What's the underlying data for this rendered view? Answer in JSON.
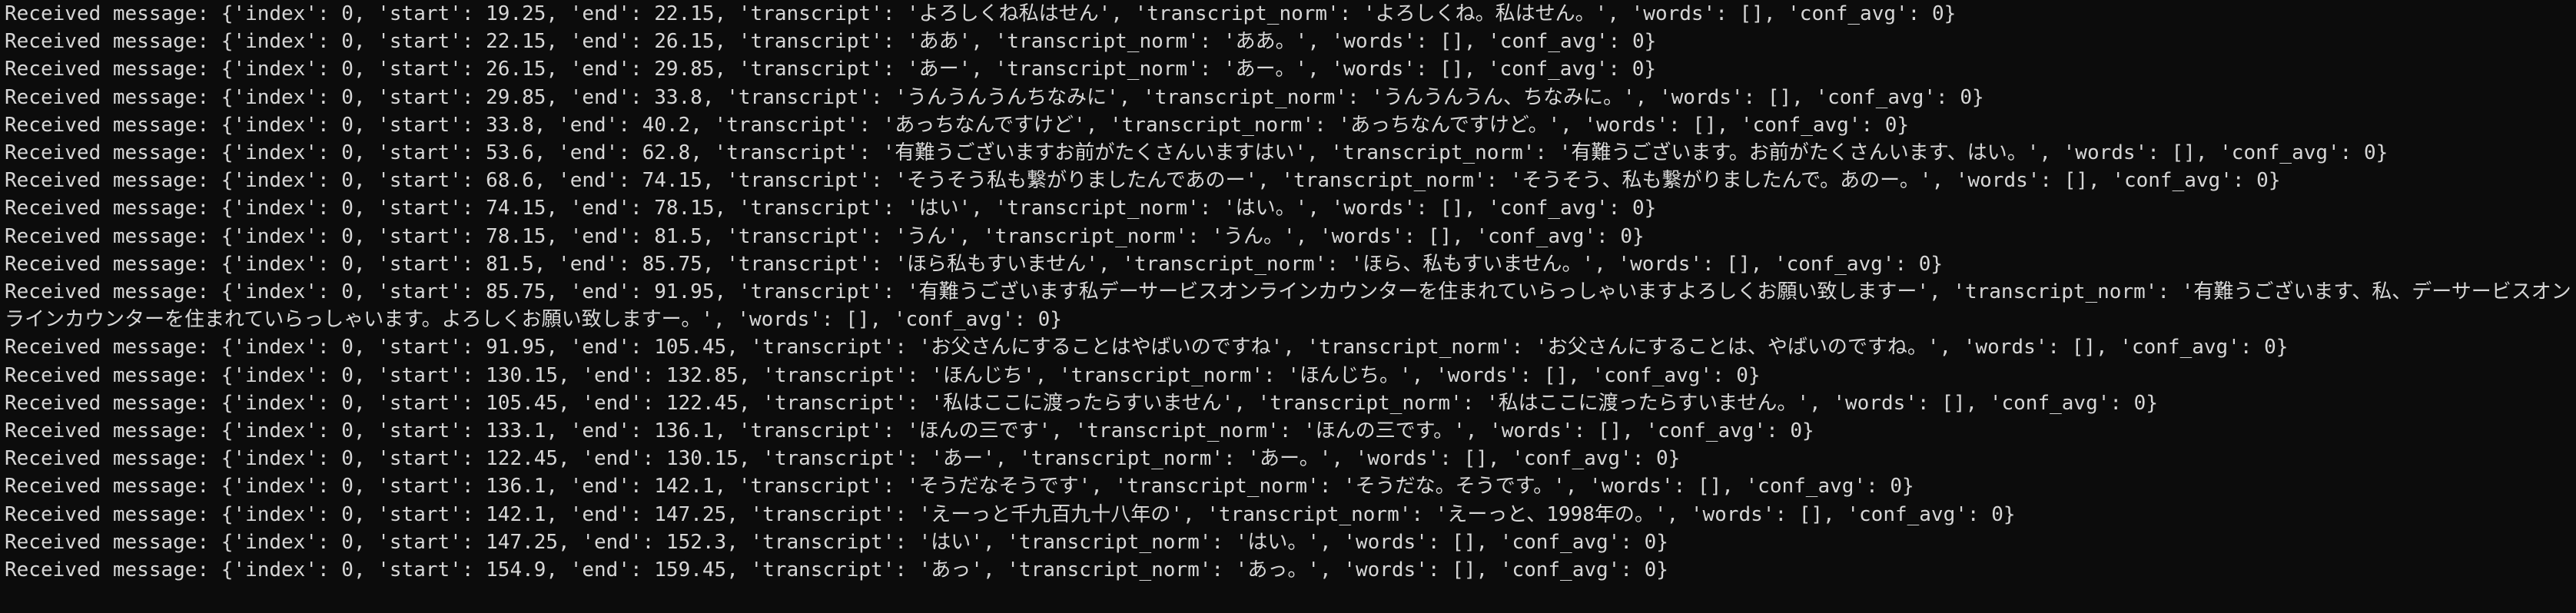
{
  "terminal": {
    "lines": [
      "Received message: {'index': 0, 'start': 19.25, 'end': 22.15, 'transcript': 'よろしくね私はせん', 'transcript_norm': 'よろしくね。私はせん。', 'words': [], 'conf_avg': 0}",
      "Received message: {'index': 0, 'start': 22.15, 'end': 26.15, 'transcript': 'ああ', 'transcript_norm': 'ああ。', 'words': [], 'conf_avg': 0}",
      "Received message: {'index': 0, 'start': 26.15, 'end': 29.85, 'transcript': 'あー', 'transcript_norm': 'あー。', 'words': [], 'conf_avg': 0}",
      "Received message: {'index': 0, 'start': 29.85, 'end': 33.8, 'transcript': 'うんうんうんちなみに', 'transcript_norm': 'うんうんうん、ちなみに。', 'words': [], 'conf_avg': 0}",
      "Received message: {'index': 0, 'start': 33.8, 'end': 40.2, 'transcript': 'あっちなんですけど', 'transcript_norm': 'あっちなんですけど。', 'words': [], 'conf_avg': 0}",
      "Received message: {'index': 0, 'start': 53.6, 'end': 62.8, 'transcript': '有難うございますお前がたくさんいますはい', 'transcript_norm': '有難うございます。お前がたくさんいます、はい。', 'words': [], 'conf_avg': 0}",
      "Received message: {'index': 0, 'start': 68.6, 'end': 74.15, 'transcript': 'そうそう私も繋がりましたんであのー', 'transcript_norm': 'そうそう、私も繋がりましたんで。あのー。', 'words': [], 'conf_avg': 0}",
      "Received message: {'index': 0, 'start': 74.15, 'end': 78.15, 'transcript': 'はい', 'transcript_norm': 'はい。', 'words': [], 'conf_avg': 0}",
      "Received message: {'index': 0, 'start': 78.15, 'end': 81.5, 'transcript': 'うん', 'transcript_norm': 'うん。', 'words': [], 'conf_avg': 0}",
      "Received message: {'index': 0, 'start': 81.5, 'end': 85.75, 'transcript': 'ほら私もすいません', 'transcript_norm': 'ほら、私もすいません。', 'words': [], 'conf_avg': 0}",
      "Received message: {'index': 0, 'start': 85.75, 'end': 91.95, 'transcript': '有難うございます私デーサービスオンラインカウンターを住まれていらっしゃいますよろしくお願い致しますー', 'transcript_norm': '有難うございます、私、デーサービスオンラインカウンターを住まれていらっしゃいます。よろしくお願い致しますー。', 'words': [], 'conf_avg': 0}",
      "Received message: {'index': 0, 'start': 91.95, 'end': 105.45, 'transcript': 'お父さんにすることはやばいのですね', 'transcript_norm': 'お父さんにすることは、やばいのですね。', 'words': [], 'conf_avg': 0}",
      "Received message: {'index': 0, 'start': 130.15, 'end': 132.85, 'transcript': 'ほんじち', 'transcript_norm': 'ほんじち。', 'words': [], 'conf_avg': 0}",
      "Received message: {'index': 0, 'start': 105.45, 'end': 122.45, 'transcript': '私はここに渡ったらすいません', 'transcript_norm': '私はここに渡ったらすいません。', 'words': [], 'conf_avg': 0}",
      "Received message: {'index': 0, 'start': 133.1, 'end': 136.1, 'transcript': 'ほんの三です', 'transcript_norm': 'ほんの三です。', 'words': [], 'conf_avg': 0}",
      "Received message: {'index': 0, 'start': 122.45, 'end': 130.15, 'transcript': 'あー', 'transcript_norm': 'あー。', 'words': [], 'conf_avg': 0}",
      "Received message: {'index': 0, 'start': 136.1, 'end': 142.1, 'transcript': 'そうだなそうです', 'transcript_norm': 'そうだな。そうです。', 'words': [], 'conf_avg': 0}",
      "Received message: {'index': 0, 'start': 142.1, 'end': 147.25, 'transcript': 'えーっと千九百九十八年の', 'transcript_norm': 'えーっと、1998年の。', 'words': [], 'conf_avg': 0}",
      "Received message: {'index': 0, 'start': 147.25, 'end': 152.3, 'transcript': 'はい', 'transcript_norm': 'はい。', 'words': [], 'conf_avg': 0}",
      "Received message: {'index': 0, 'start': 154.9, 'end': 159.45, 'transcript': 'あっ', 'transcript_norm': 'あっ。', 'words': [], 'conf_avg': 0}"
    ]
  },
  "colors": {
    "background": "#0c0c0c",
    "text": "#d7d7d7"
  }
}
